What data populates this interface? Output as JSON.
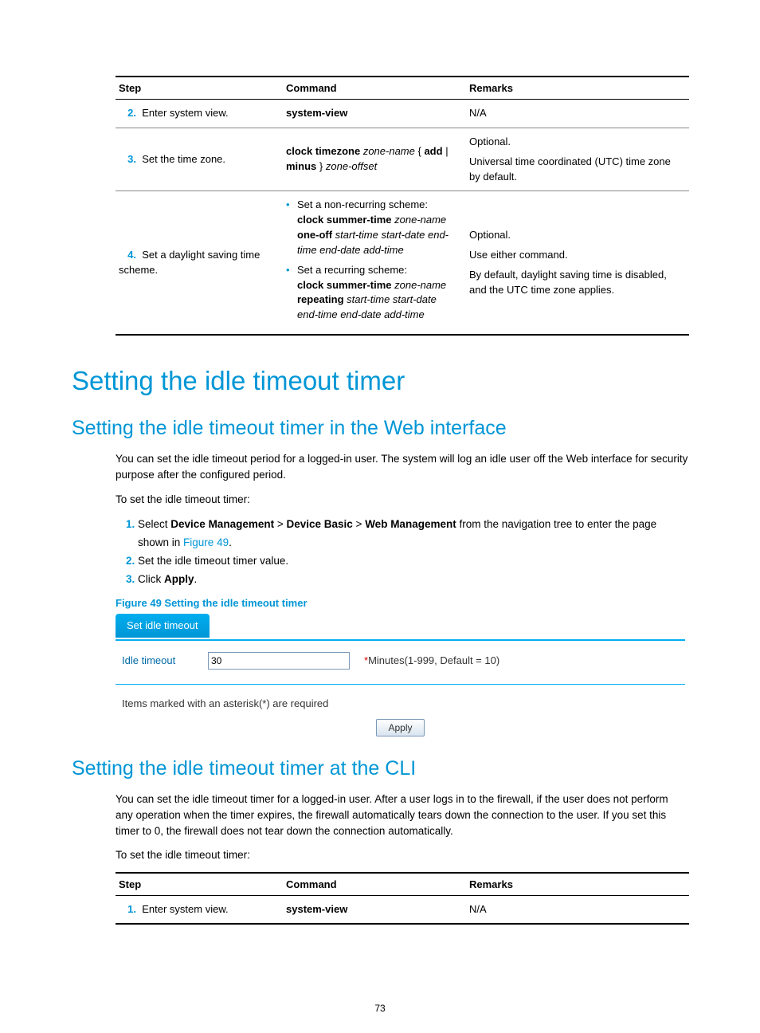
{
  "table1": {
    "headers": [
      "Step",
      "Command",
      "Remarks"
    ],
    "rows": [
      {
        "num": "2.",
        "step": "Enter system view.",
        "cmd_bold": "system-view",
        "remarks": "N/A"
      },
      {
        "num": "3.",
        "step": "Set the time zone.",
        "remarks_opt": "Optional.",
        "remarks_body": "Universal time coordinated (UTC) time zone by default."
      },
      {
        "num": "4.",
        "step": "Set a daylight saving time scheme.",
        "bullet1_lead": "Set a non-recurring scheme:",
        "bullet2_lead": "Set a recurring scheme:",
        "remarks_opt": "Optional.",
        "remarks_use": "Use either command.",
        "remarks_body": "By default, daylight saving time is disabled, and the UTC time zone applies."
      }
    ],
    "cmd3": {
      "p1b": "clock timezone",
      "p1i": "zone-name",
      "p2": " { ",
      "p2b": "add",
      "p3": " | ",
      "p3b": "minus",
      "p4": " } ",
      "p4i": "zone-offset"
    },
    "cmd4a": {
      "b1": "clock summer-time",
      "i1": "zone-name",
      "b2": "one-off",
      "i2": "start-time start-date end-time end-date add-time"
    },
    "cmd4b": {
      "b1": "clock summer-time",
      "i1": "zone-name",
      "b2": "repeating",
      "i2": "start-time start-date end-time end-date add-time"
    }
  },
  "h1": "Setting the idle timeout timer",
  "h2a": "Setting the idle timeout timer in the Web interface",
  "p1": "You can set the idle timeout period for a logged-in user. The system will log an idle user off the Web interface for security purpose after the configured period.",
  "p2": "To set the idle timeout timer:",
  "ol1": {
    "s1a": "Select ",
    "s1b1": "Device Management",
    "s1c": " > ",
    "s1b2": "Device Basic",
    "s1b3": "Web Management",
    "s1d": " from the navigation tree to enter the page shown in ",
    "s1link": "Figure 49",
    "s1e": ".",
    "s2": "Set the idle timeout timer value.",
    "s3a": "Click ",
    "s3b": "Apply",
    "s3c": "."
  },
  "figcap": "Figure 49 Setting the idle timeout timer",
  "figure": {
    "tab": "Set idle timeout",
    "label": "Idle timeout",
    "value": "30",
    "hint_star": "*",
    "hint": "Minutes(1-999, Default = 10)",
    "note": "Items marked with an asterisk(*) are required",
    "apply": "Apply"
  },
  "h2b": "Setting the idle timeout timer at the CLI",
  "p3": "You can set the idle timeout timer for a logged-in user. After a user logs in to the firewall, if the user does not perform any operation when the timer expires, the firewall automatically tears down the connection to the user. If you set this timer to 0, the firewall does not tear down the connection automatically.",
  "p4": "To set the idle timeout timer:",
  "table2": {
    "headers": [
      "Step",
      "Command",
      "Remarks"
    ],
    "row": {
      "num": "1.",
      "step": "Enter system view.",
      "cmd": "system-view",
      "remarks": "N/A"
    }
  },
  "pagenum": "73"
}
